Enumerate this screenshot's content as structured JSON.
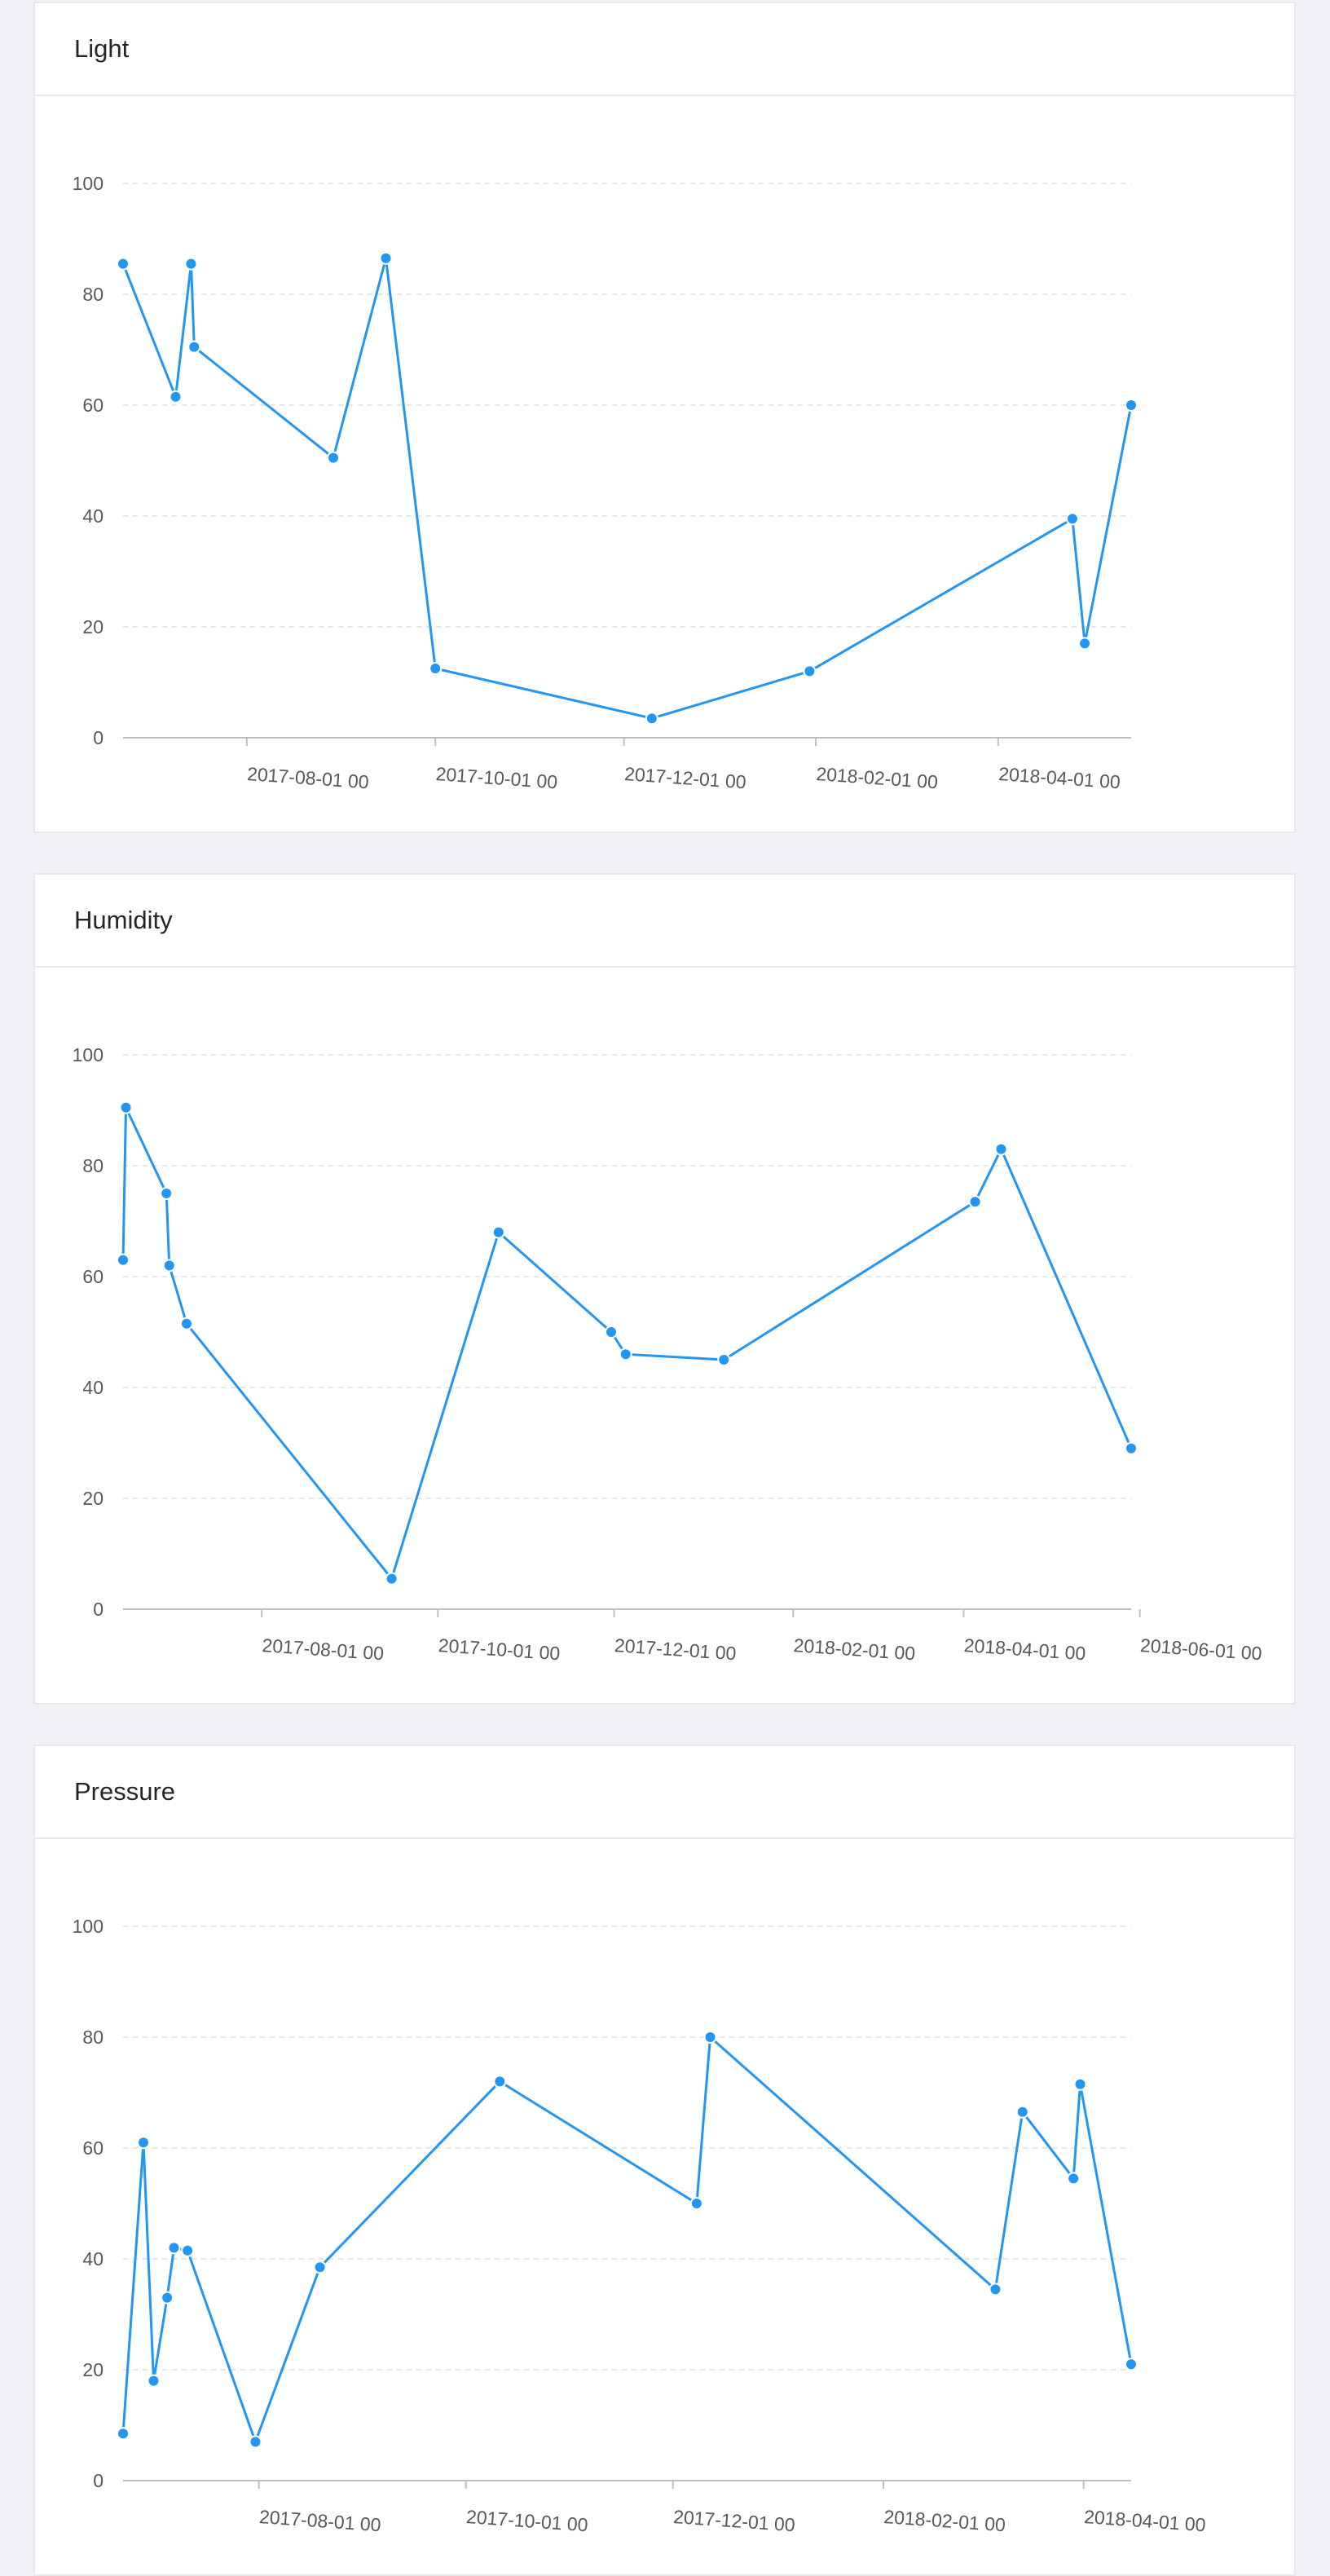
{
  "chart_data": [
    {
      "type": "line",
      "title": "Light",
      "color": "#2196f3",
      "ylim": [
        0,
        100
      ],
      "yticks": [
        "0",
        "20",
        "40",
        "60",
        "80",
        "100"
      ],
      "xlim": [
        "2017-06-22",
        "2018-05-14"
      ],
      "xticks": [
        {
          "date": "2017-08-01",
          "label": "2017-08-01 00"
        },
        {
          "date": "2017-10-01",
          "label": "2017-10-01 00"
        },
        {
          "date": "2017-12-01",
          "label": "2017-12-01 00"
        },
        {
          "date": "2018-02-01",
          "label": "2018-02-01 00"
        },
        {
          "date": "2018-04-01",
          "label": "2018-04-01 00"
        }
      ],
      "grid": true,
      "points": [
        {
          "x": "2017-06-22",
          "y": 85.5
        },
        {
          "x": "2017-07-09",
          "y": 61.5
        },
        {
          "x": "2017-07-14",
          "y": 85.5
        },
        {
          "x": "2017-07-15",
          "y": 70.5
        },
        {
          "x": "2017-08-29",
          "y": 50.5
        },
        {
          "x": "2017-09-15",
          "y": 86.5
        },
        {
          "x": "2017-10-01",
          "y": 12.5
        },
        {
          "x": "2017-12-10",
          "y": 3.5
        },
        {
          "x": "2018-01-30",
          "y": 12.0
        },
        {
          "x": "2018-04-25",
          "y": 39.5
        },
        {
          "x": "2018-04-29",
          "y": 17.0
        },
        {
          "x": "2018-05-14",
          "y": 60.0
        }
      ]
    },
    {
      "type": "line",
      "title": "Humidity",
      "color": "#2196f3",
      "ylim": [
        0,
        100
      ],
      "yticks": [
        "0",
        "20",
        "40",
        "60",
        "80",
        "100"
      ],
      "xlim": [
        "2017-06-14",
        "2018-05-29"
      ],
      "xticks": [
        {
          "date": "2017-08-01",
          "label": "2017-08-01 00"
        },
        {
          "date": "2017-10-01",
          "label": "2017-10-01 00"
        },
        {
          "date": "2017-12-01",
          "label": "2017-12-01 00"
        },
        {
          "date": "2018-02-01",
          "label": "2018-02-01 00"
        },
        {
          "date": "2018-04-01",
          "label": "2018-04-01 00"
        },
        {
          "date": "2018-06-01",
          "label": "2018-06-01 00"
        }
      ],
      "grid": true,
      "points": [
        {
          "x": "2017-06-14",
          "y": 63.0
        },
        {
          "x": "2017-06-15",
          "y": 90.5
        },
        {
          "x": "2017-06-29",
          "y": 75.0
        },
        {
          "x": "2017-06-30",
          "y": 62.0
        },
        {
          "x": "2017-07-06",
          "y": 51.5
        },
        {
          "x": "2017-09-15",
          "y": 5.5
        },
        {
          "x": "2017-10-22",
          "y": 68.0
        },
        {
          "x": "2017-11-30",
          "y": 50.0
        },
        {
          "x": "2017-12-05",
          "y": 46.0
        },
        {
          "x": "2018-01-08",
          "y": 45.0
        },
        {
          "x": "2018-04-05",
          "y": 73.5
        },
        {
          "x": "2018-04-14",
          "y": 83.0
        },
        {
          "x": "2018-05-29",
          "y": 29.0
        }
      ]
    },
    {
      "type": "line",
      "title": "Pressure",
      "color": "#2196f3",
      "ylim": [
        0,
        100
      ],
      "yticks": [
        "0",
        "20",
        "40",
        "60",
        "80",
        "100"
      ],
      "xlim": [
        "2017-06-22",
        "2018-04-15"
      ],
      "xticks": [
        {
          "date": "2017-08-01",
          "label": "2017-08-01 00"
        },
        {
          "date": "2017-10-01",
          "label": "2017-10-01 00"
        },
        {
          "date": "2017-12-01",
          "label": "2017-12-01 00"
        },
        {
          "date": "2018-02-01",
          "label": "2018-02-01 00"
        },
        {
          "date": "2018-04-01",
          "label": "2018-04-01 00"
        }
      ],
      "grid": true,
      "points": [
        {
          "x": "2017-06-22",
          "y": 8.5
        },
        {
          "x": "2017-06-28",
          "y": 61.0
        },
        {
          "x": "2017-07-01",
          "y": 18.0
        },
        {
          "x": "2017-07-05",
          "y": 33.0
        },
        {
          "x": "2017-07-07",
          "y": 42.0
        },
        {
          "x": "2017-07-11",
          "y": 41.5
        },
        {
          "x": "2017-07-31",
          "y": 7.0
        },
        {
          "x": "2017-08-19",
          "y": 38.5
        },
        {
          "x": "2017-10-11",
          "y": 72.0
        },
        {
          "x": "2017-12-08",
          "y": 50.0
        },
        {
          "x": "2017-12-12",
          "y": 80.0
        },
        {
          "x": "2018-03-06",
          "y": 34.5
        },
        {
          "x": "2018-03-14",
          "y": 66.5
        },
        {
          "x": "2018-03-29",
          "y": 54.5
        },
        {
          "x": "2018-03-31",
          "y": 71.5
        },
        {
          "x": "2018-04-15",
          "y": 21.0
        }
      ]
    }
  ]
}
